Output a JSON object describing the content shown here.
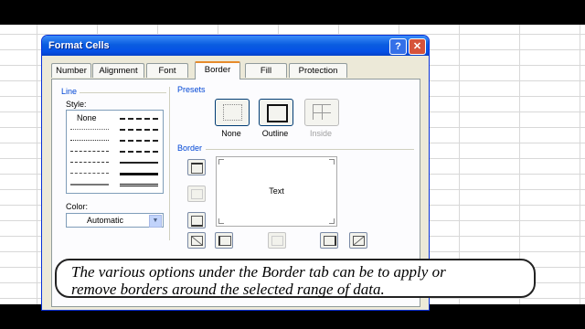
{
  "dialog": {
    "title": "Format Cells",
    "help_label": "?",
    "close_label": "✕"
  },
  "tabs": [
    "Number",
    "Alignment",
    "Font",
    "Border",
    "Fill",
    "Protection"
  ],
  "line": {
    "group_label": "Line",
    "style_label": "Style:",
    "none_label": "None",
    "color_label": "Color:",
    "color_value": "Automatic"
  },
  "presets": {
    "group_label": "Presets",
    "items": [
      "None",
      "Outline",
      "Inside"
    ]
  },
  "border": {
    "group_label": "Border",
    "preview_text": "Text"
  },
  "caption": {
    "line1": "The various options under the Border tab can be to apply or",
    "line2": "remove borders around the selected range of data."
  },
  "colors": {
    "titlebar": "#0550e6",
    "group_label": "#0046d5",
    "active_tab_accent": "#e68b2c",
    "dialog_bg": "#ece9d8"
  }
}
